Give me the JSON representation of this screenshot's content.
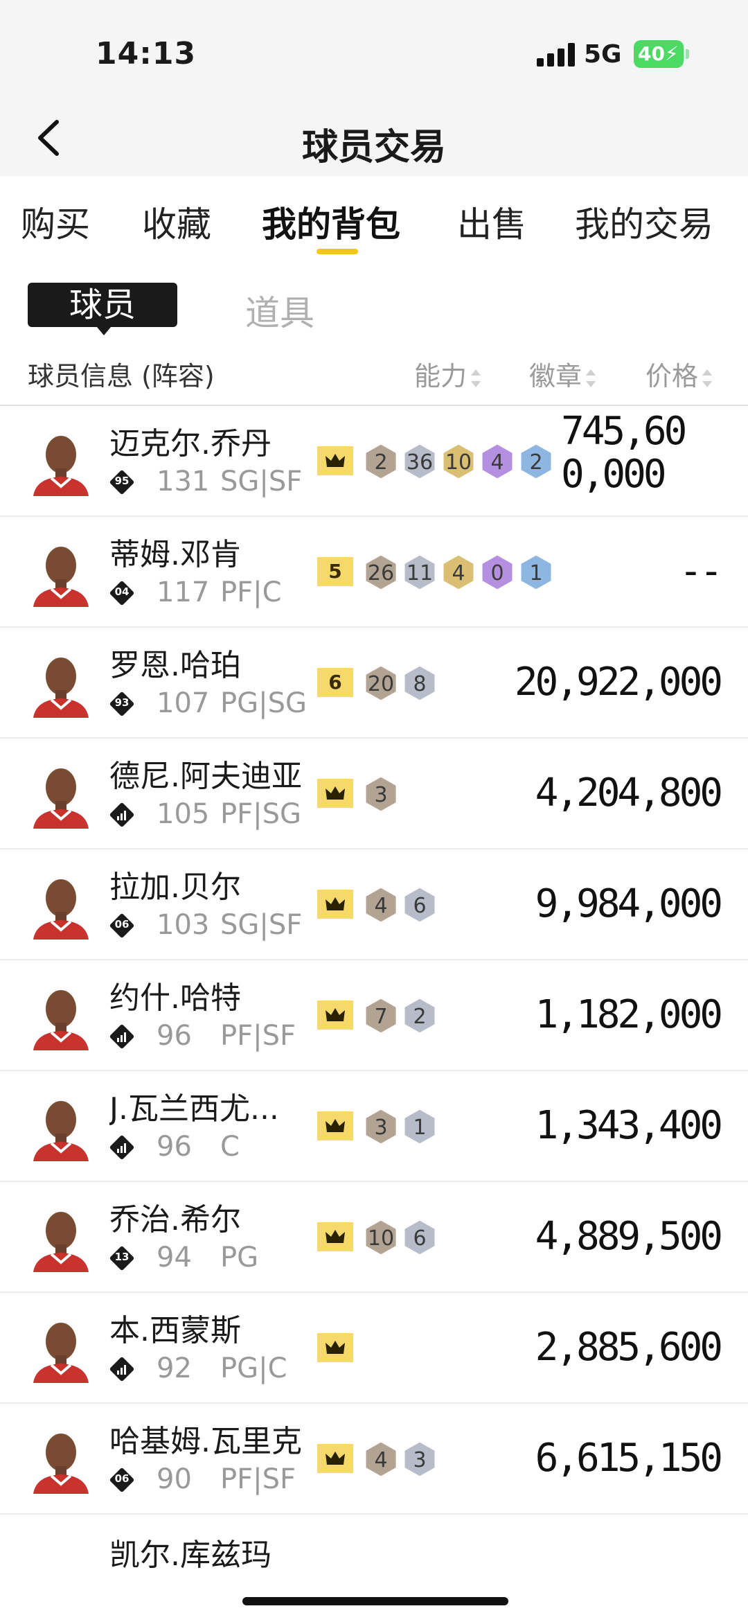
{
  "status_bar": {
    "time": "14:13",
    "network": "5G",
    "battery": "40"
  },
  "nav": {
    "title": "球员交易"
  },
  "tabs": [
    {
      "label": "购买",
      "active": false
    },
    {
      "label": "收藏",
      "active": false
    },
    {
      "label": "我的背包",
      "active": true
    },
    {
      "label": "出售",
      "active": false
    },
    {
      "label": "我的交易",
      "active": false
    }
  ],
  "subtabs": {
    "active": "球员",
    "inactive": "道具"
  },
  "header": {
    "info": "球员信息 (阵容)",
    "ability": "能力",
    "badges": "徽章",
    "price": "价格"
  },
  "colors": {
    "accent": "#f5c518",
    "crown": "#f6d96b",
    "bronze": "#b3a393",
    "silver": "#b7bcc8",
    "gold": "#d9bf73",
    "purple": "#b590e0",
    "blue": "#8db6e0"
  },
  "players": [
    {
      "name": "迈克尔.乔丹",
      "rank": "95",
      "ovr": "131",
      "pos": "SG|SF",
      "crown": "crown",
      "badges": [
        "2",
        "36",
        "10",
        "4",
        "2"
      ],
      "price": "745,600,000"
    },
    {
      "name": "蒂姆.邓肯",
      "rank": "04",
      "ovr": "117",
      "pos": "PF|C",
      "crown": "5",
      "badges": [
        "26",
        "11",
        "4",
        "0",
        "1"
      ],
      "price": "--"
    },
    {
      "name": "罗恩.哈珀",
      "rank": "93",
      "ovr": "107",
      "pos": "PG|SG",
      "crown": "6",
      "badges": [
        "20",
        "8"
      ],
      "price": "20,922,000"
    },
    {
      "name": "德尼.阿夫迪亚",
      "rank": "",
      "ovr": "105",
      "pos": "PF|SG",
      "crown": "crown",
      "badges": [
        "3"
      ],
      "price": "4,204,800"
    },
    {
      "name": "拉加.贝尔",
      "rank": "06",
      "ovr": "103",
      "pos": "SG|SF",
      "crown": "crown",
      "badges": [
        "4",
        "6"
      ],
      "price": "9,984,000"
    },
    {
      "name": "约什.哈特",
      "rank": "",
      "ovr": "96",
      "pos": "PF|SF",
      "crown": "crown",
      "badges": [
        "7",
        "2"
      ],
      "price": "1,182,000"
    },
    {
      "name": "J.瓦兰西尤...",
      "rank": "",
      "ovr": "96",
      "pos": "C",
      "crown": "crown",
      "badges": [
        "3",
        "1"
      ],
      "price": "1,343,400"
    },
    {
      "name": "乔治.希尔",
      "rank": "13",
      "ovr": "94",
      "pos": "PG",
      "crown": "crown",
      "badges": [
        "10",
        "6"
      ],
      "price": "4,889,500"
    },
    {
      "name": "本.西蒙斯",
      "rank": "",
      "ovr": "92",
      "pos": "PG|C",
      "crown": "crown",
      "badges": [],
      "price": "2,885,600"
    },
    {
      "name": "哈基姆.瓦里克",
      "rank": "06",
      "ovr": "90",
      "pos": "PF|SF",
      "crown": "crown",
      "badges": [
        "4",
        "3"
      ],
      "price": "6,615,150"
    }
  ],
  "partial_player": {
    "name": "凯尔.库兹玛"
  }
}
